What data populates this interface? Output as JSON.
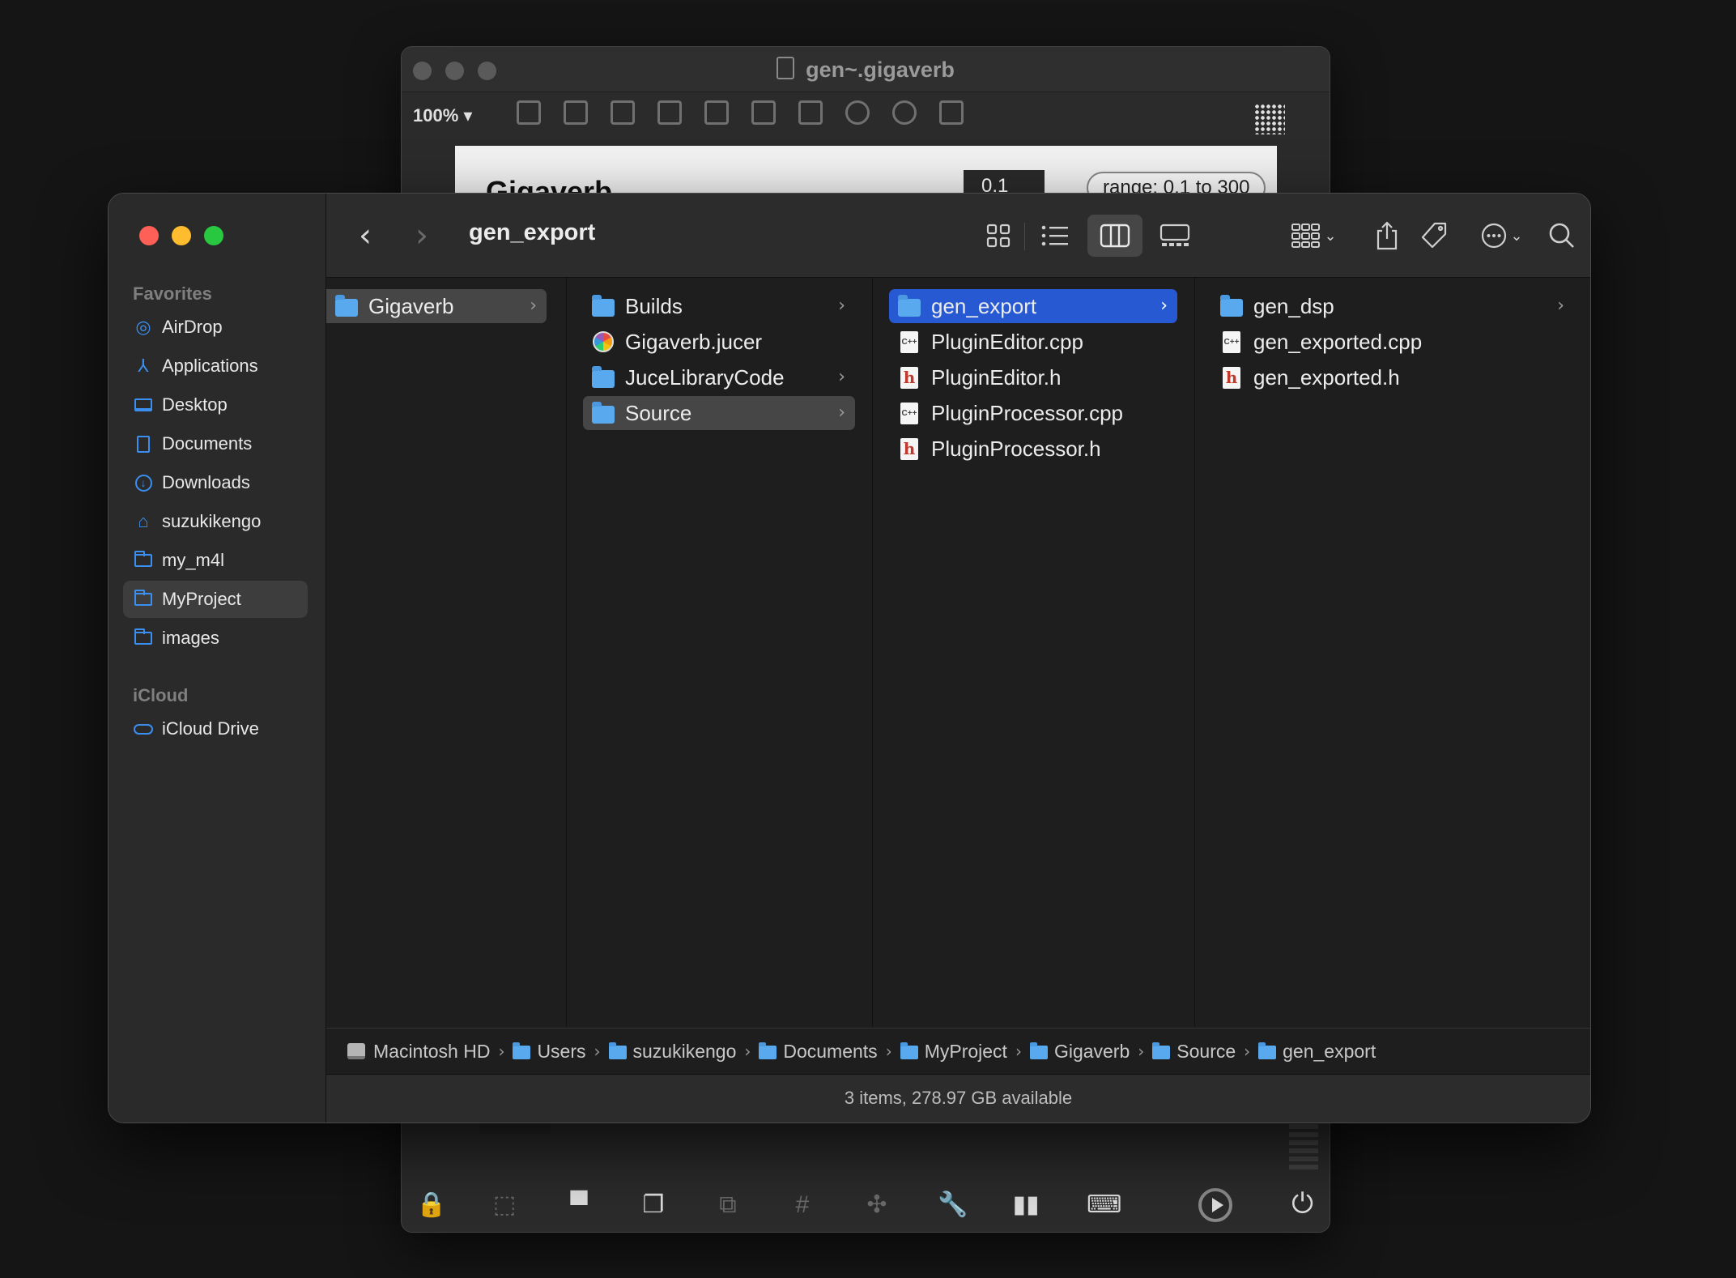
{
  "max_window": {
    "title": "gen~.gigaverb",
    "zoom": "100%",
    "canvas_title": "Gigaverb",
    "number_box": "0.1",
    "range_comment": "range: 0.1 to 300"
  },
  "finder": {
    "window_title": "gen_export",
    "sidebar": {
      "favorites_header": "Favorites",
      "favorites": [
        {
          "label": "AirDrop",
          "icon": "airdrop-icon"
        },
        {
          "label": "Applications",
          "icon": "applications-icon"
        },
        {
          "label": "Desktop",
          "icon": "desktop-icon"
        },
        {
          "label": "Documents",
          "icon": "document-icon"
        },
        {
          "label": "Downloads",
          "icon": "download-icon"
        },
        {
          "label": "suzukikengo",
          "icon": "home-icon"
        },
        {
          "label": "my_m4l",
          "icon": "folder-icon"
        },
        {
          "label": "MyProject",
          "icon": "folder-icon",
          "selected": true
        },
        {
          "label": "images",
          "icon": "folder-icon"
        }
      ],
      "icloud_header": "iCloud",
      "icloud": [
        {
          "label": "iCloud Drive",
          "icon": "cloud-icon"
        }
      ]
    },
    "columns": [
      {
        "items": [
          {
            "label": "Gigaverb",
            "type": "folder",
            "selected": "gray",
            "has_children": true
          }
        ]
      },
      {
        "items": [
          {
            "label": "Builds",
            "type": "folder",
            "has_children": true
          },
          {
            "label": "Gigaverb.jucer",
            "type": "jucer"
          },
          {
            "label": "JuceLibraryCode",
            "type": "folder",
            "has_children": true
          },
          {
            "label": "Source",
            "type": "folder",
            "selected": "gray",
            "has_children": true
          }
        ]
      },
      {
        "items": [
          {
            "label": "gen_export",
            "type": "folder",
            "selected": "blue",
            "has_children": true
          },
          {
            "label": "PluginEditor.cpp",
            "type": "cpp"
          },
          {
            "label": "PluginEditor.h",
            "type": "h"
          },
          {
            "label": "PluginProcessor.cpp",
            "type": "cpp"
          },
          {
            "label": "PluginProcessor.h",
            "type": "h"
          }
        ]
      },
      {
        "items": [
          {
            "label": "gen_dsp",
            "type": "folder",
            "has_children": true
          },
          {
            "label": "gen_exported.cpp",
            "type": "cpp"
          },
          {
            "label": "gen_exported.h",
            "type": "h"
          }
        ]
      }
    ],
    "file_badges": {
      "cpp": "C++",
      "h": "h"
    },
    "path_bar": [
      "Macintosh HD",
      "Users",
      "suzukikengo",
      "Documents",
      "MyProject",
      "Gigaverb",
      "Source",
      "gen_export"
    ],
    "status": "3 items, 278.97 GB available"
  }
}
